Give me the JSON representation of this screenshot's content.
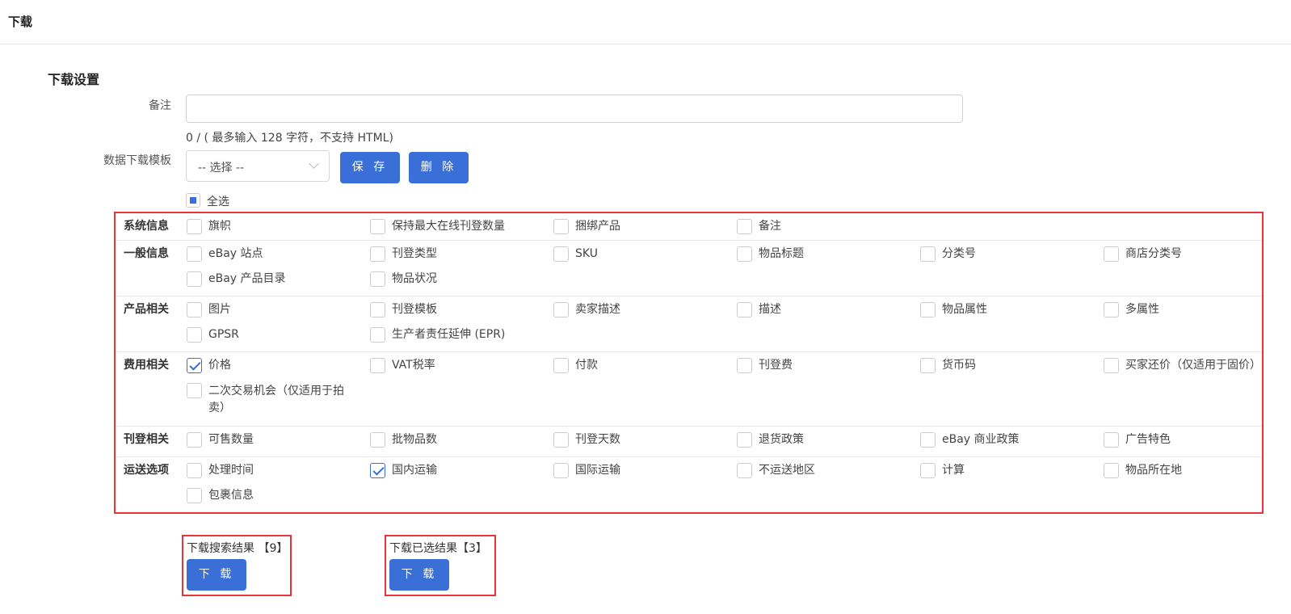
{
  "header": {
    "title": "下载"
  },
  "section": {
    "title": "下载设置"
  },
  "remark": {
    "label": "备注",
    "value": "",
    "counter": "0 / ( 最多输入 128 字符，不支持 HTML)"
  },
  "template": {
    "label": "数据下载模板",
    "selected": "-- 选择 --",
    "save_label": "保 存",
    "delete_label": "删 除"
  },
  "select_all": {
    "label": "全选",
    "state": "partial"
  },
  "categories": [
    {
      "label": "系统信息",
      "items": [
        {
          "label": "旗帜",
          "checked": false
        },
        {
          "label": "保持最大在线刊登数量",
          "checked": false
        },
        {
          "label": "捆绑产品",
          "checked": false
        },
        {
          "label": "备注",
          "checked": false
        }
      ]
    },
    {
      "label": "一般信息",
      "items": [
        {
          "label": "eBay 站点",
          "checked": false
        },
        {
          "label": "刊登类型",
          "checked": false
        },
        {
          "label": "SKU",
          "checked": false
        },
        {
          "label": "物品标题",
          "checked": false
        },
        {
          "label": "分类号",
          "checked": false
        },
        {
          "label": "商店分类号",
          "checked": false
        },
        {
          "label": "eBay 产品目录",
          "checked": false
        },
        {
          "label": "物品状况",
          "checked": false
        }
      ]
    },
    {
      "label": "产品相关",
      "items": [
        {
          "label": "图片",
          "checked": false
        },
        {
          "label": "刊登模板",
          "checked": false
        },
        {
          "label": "卖家描述",
          "checked": false
        },
        {
          "label": "描述",
          "checked": false
        },
        {
          "label": "物品属性",
          "checked": false
        },
        {
          "label": "多属性",
          "checked": false
        },
        {
          "label": "GPSR",
          "checked": false
        },
        {
          "label": "生产者责任延伸 (EPR)",
          "checked": false
        }
      ]
    },
    {
      "label": "费用相关",
      "items": [
        {
          "label": "价格",
          "checked": true
        },
        {
          "label": "VAT税率",
          "checked": false
        },
        {
          "label": "付款",
          "checked": false
        },
        {
          "label": "刊登费",
          "checked": false
        },
        {
          "label": "货币码",
          "checked": false
        },
        {
          "label": "买家还价（仅适用于固价）",
          "checked": false
        },
        {
          "label": "二次交易机会（仅适用于拍卖）",
          "checked": false
        }
      ]
    },
    {
      "label": "刊登相关",
      "items": [
        {
          "label": "可售数量",
          "checked": false
        },
        {
          "label": "批物品数",
          "checked": false
        },
        {
          "label": "刊登天数",
          "checked": false
        },
        {
          "label": "退货政策",
          "checked": false
        },
        {
          "label": "eBay 商业政策",
          "checked": false
        },
        {
          "label": "广告特色",
          "checked": false
        }
      ]
    },
    {
      "label": "运送选项",
      "items": [
        {
          "label": "处理时间",
          "checked": false
        },
        {
          "label": "国内运输",
          "checked": true
        },
        {
          "label": "国际运输",
          "checked": false
        },
        {
          "label": "不运送地区",
          "checked": false
        },
        {
          "label": "计算",
          "checked": false
        },
        {
          "label": "物品所在地",
          "checked": false
        },
        {
          "label": "包裹信息",
          "checked": false
        }
      ]
    }
  ],
  "downloads": [
    {
      "caption": "下载搜索结果 【9】",
      "button_label": "下 载"
    },
    {
      "caption": "下载已选结果【3】",
      "button_label": "下 载"
    }
  ],
  "colors": {
    "primary": "#3a6fd8",
    "highlight_border": "#e8333a"
  }
}
